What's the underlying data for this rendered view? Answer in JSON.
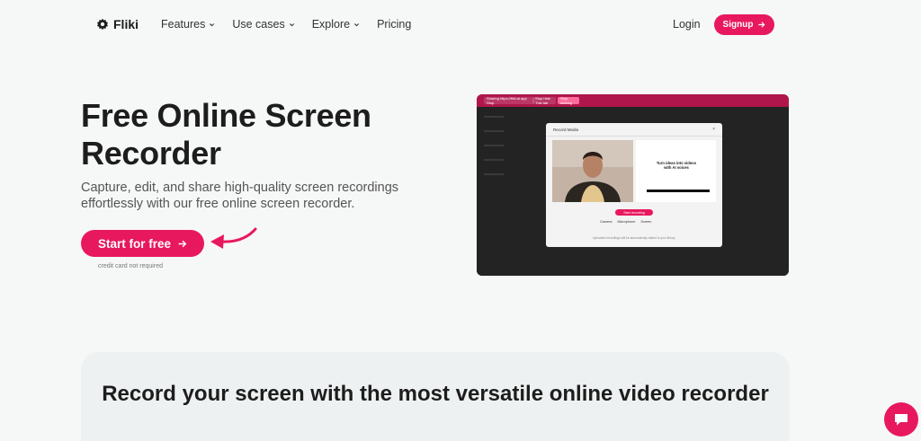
{
  "nav": {
    "logo_text": "Fliki",
    "items": [
      {
        "label": "Features",
        "has_dropdown": true
      },
      {
        "label": "Use cases",
        "has_dropdown": true
      },
      {
        "label": "Explore",
        "has_dropdown": true
      },
      {
        "label": "Pricing",
        "has_dropdown": false
      }
    ],
    "login_label": "Login",
    "signup_label": "Signup"
  },
  "hero": {
    "title": "Free Online Screen Recorder",
    "subtitle": "Capture, edit, and share high-quality screen recordings effortlessly with our free online screen recorder.",
    "cta_label": "Start for free",
    "cta_note": "credit card not required"
  },
  "preview": {
    "browser_chips": [
      "Sharing https://fliki.ai app Stop",
      "Stop hide This tab",
      "Stop sharing"
    ],
    "modal_title": "Record Media",
    "modal_close": "×",
    "preview_headline": "Turn ideas into videos with AI voices",
    "start_recording_label": "Start recording",
    "options": [
      "Camera",
      "Microphone",
      "Screen"
    ],
    "footer_note": "Uploaded recordings will be automatically added to your library"
  },
  "section": {
    "title": "Record your screen with the most versatile online video recorder"
  },
  "colors": {
    "accent": "#e8185e",
    "background": "#f6f7f7",
    "text": "#1d1d1d"
  }
}
